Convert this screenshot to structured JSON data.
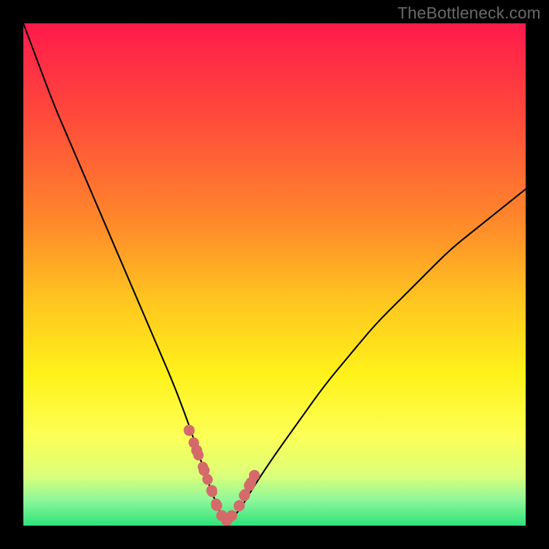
{
  "watermark": "TheBottleneck.com",
  "chart_data": {
    "type": "line",
    "title": "",
    "xlabel": "",
    "ylabel": "",
    "xlim": [
      0,
      100
    ],
    "ylim": [
      0,
      100
    ],
    "grid": false,
    "legend": false,
    "series": [
      {
        "name": "bottleneck-curve",
        "x": [
          0,
          3,
          6,
          9,
          12,
          15,
          18,
          21,
          24,
          27,
          30,
          33,
          35,
          37,
          39,
          40,
          41,
          43,
          46,
          50,
          55,
          60,
          65,
          70,
          75,
          80,
          85,
          90,
          95,
          100
        ],
        "y": [
          100,
          92,
          84,
          77,
          70,
          63,
          56,
          49,
          42,
          35,
          28,
          20,
          14,
          8,
          3,
          1,
          1,
          3,
          8,
          14,
          21,
          28,
          34,
          40,
          45,
          50,
          55,
          59,
          63,
          67
        ]
      },
      {
        "name": "highlighted-dip",
        "x": [
          33,
          34.5,
          36,
          37.5,
          38.5,
          39.5,
          40.5,
          41.5,
          43,
          44,
          45,
          46
        ],
        "y": [
          19,
          15,
          11,
          7,
          4,
          2,
          1,
          2,
          4,
          6,
          8,
          10
        ],
        "style": "dotted-thick"
      }
    ],
    "background_gradient": {
      "stops": [
        {
          "pos": 0.0,
          "color": "#ff1a4b"
        },
        {
          "pos": 0.2,
          "color": "#ff4e3a"
        },
        {
          "pos": 0.4,
          "color": "#ff8a2a"
        },
        {
          "pos": 0.55,
          "color": "#ffc51f"
        },
        {
          "pos": 0.7,
          "color": "#fff21a"
        },
        {
          "pos": 0.82,
          "color": "#fcff55"
        },
        {
          "pos": 0.9,
          "color": "#dcff7a"
        },
        {
          "pos": 0.95,
          "color": "#8cf79a"
        },
        {
          "pos": 1.0,
          "color": "#2ee27a"
        }
      ]
    },
    "colors": {
      "curve": "#000000",
      "highlight": "#d46a6a",
      "frame": "#000000"
    }
  }
}
